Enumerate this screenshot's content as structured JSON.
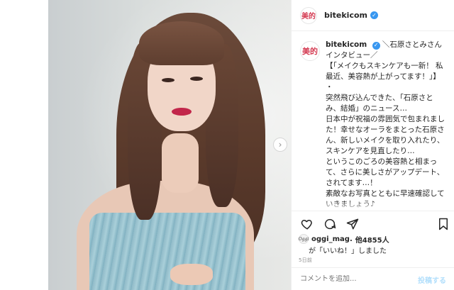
{
  "account": {
    "handle": "bitekicom",
    "avatar_text": "美的",
    "verified_mark": "✓"
  },
  "caption": {
    "text": "＼石原さとみさんインタビュー／\n【「メイクもスキンケアも一新！ 私最近、美容熱が上がってます！」】\n・\n突然飛び込んできた、「石原さとみ、結婚」のニュース…\n日本中が祝福の雰囲気で包まれました！幸せなオーラをまとった石原さん、新しいメイクを取り入れたり、スキンケアを見直したり…\nというこのごろの美容熱と相まって、さらに美しさがアップデート、されてます…！\n素敵なお写真とともに早速確認していきましょう♪\n・\n「自分の心を豊かにする方法をたくさん見つけていきたい」"
  },
  "carousel": {
    "next_glyph": "›"
  },
  "actions": {
    "like_icon": "heart-icon",
    "comment_icon": "comment-icon",
    "share_icon": "share-icon",
    "save_icon": "bookmark-icon"
  },
  "likes": {
    "avatar_text": "Oggi",
    "user": "oggi_mag.",
    "count_text": "他4855人",
    "line2": "が「いいね！」しました"
  },
  "timestamp": "5日前",
  "comment": {
    "placeholder": "コメントを追加...",
    "post_label": "投稿する"
  },
  "colors": {
    "brand_red": "#d43b52",
    "verified_blue": "#3897f0",
    "post_disabled": "#b2dffc"
  }
}
